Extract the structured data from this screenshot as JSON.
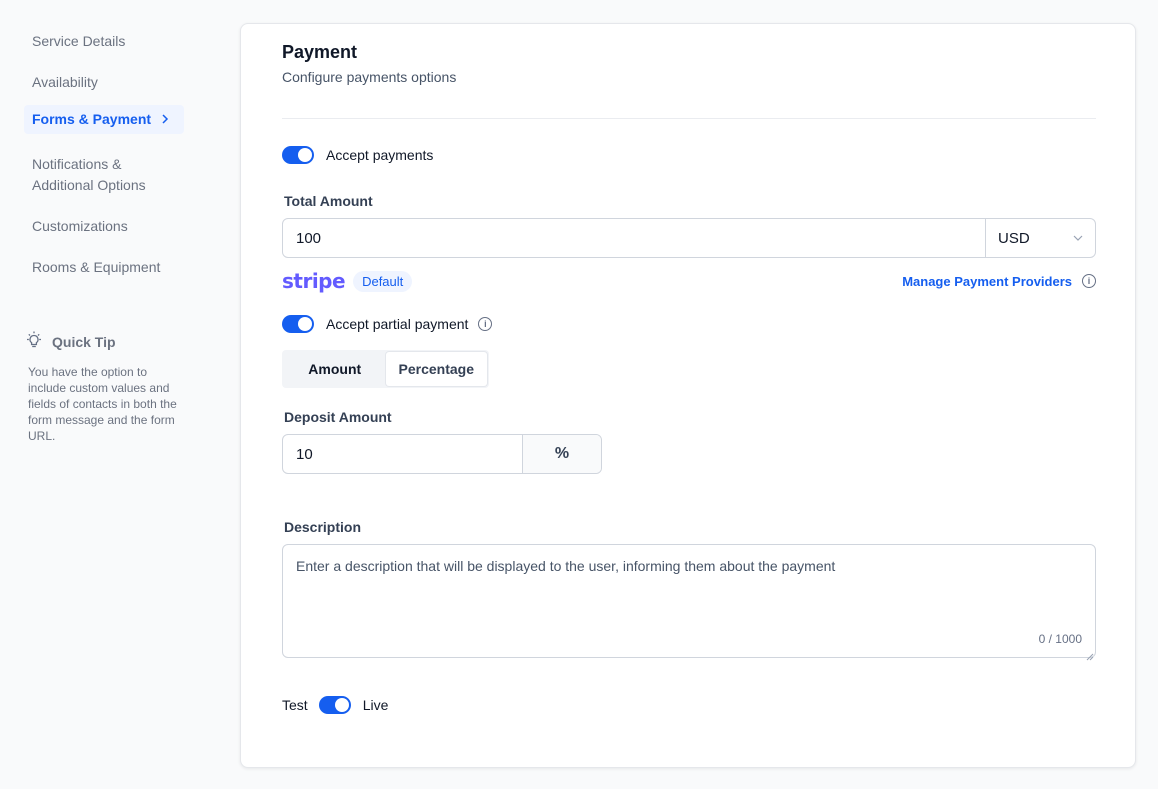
{
  "sidebar": {
    "items": [
      {
        "label": "Service Details"
      },
      {
        "label": "Availability"
      },
      {
        "label": "Forms & Payment"
      },
      {
        "label": "Notifications & Additional Options"
      },
      {
        "label": "Customizations"
      },
      {
        "label": "Rooms & Equipment"
      }
    ],
    "active_index": 2,
    "tip": {
      "title": "Quick Tip",
      "body": "You have the option to include custom values and fields of contacts in both the form message and the form URL."
    }
  },
  "payment": {
    "title": "Payment",
    "subtitle": "Configure payments options",
    "accept_payments": {
      "label": "Accept payments",
      "enabled": true
    },
    "total_amount": {
      "label": "Total Amount",
      "value": "100",
      "currency": "USD"
    },
    "provider": {
      "name": "stripe",
      "badge": "Default",
      "manage_label": "Manage Payment Providers"
    },
    "partial_payment": {
      "label": "Accept partial payment",
      "enabled": true
    },
    "mode_tabs": [
      {
        "label": "Amount",
        "selected": false
      },
      {
        "label": "Percentage",
        "selected": true
      }
    ],
    "deposit": {
      "label": "Deposit Amount",
      "value": "10",
      "suffix": "%"
    },
    "description": {
      "label": "Description",
      "placeholder": "Enter a description that will be displayed to the user, informing them about the payment",
      "counter": "0 / 1000"
    },
    "mode_switch": {
      "left_label": "Test",
      "right_label": "Live",
      "live": true
    }
  },
  "colors": {
    "accent": "#155eef",
    "stripe": "#635bff"
  }
}
